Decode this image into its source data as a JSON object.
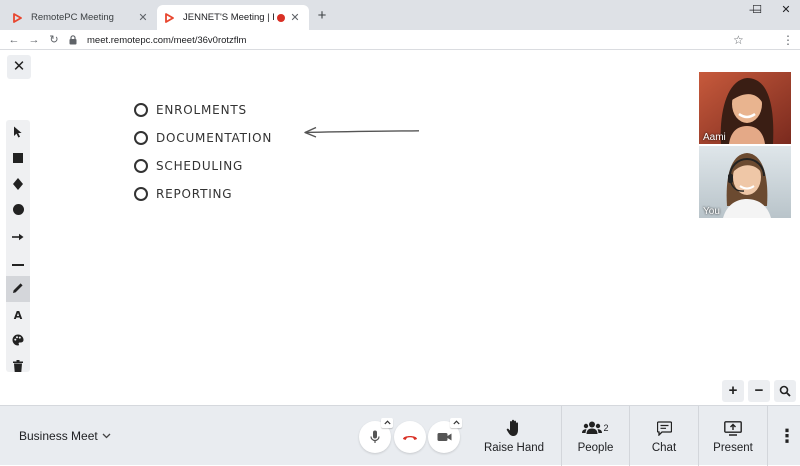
{
  "browser": {
    "tabs": [
      {
        "label": "RemotePC Meeting"
      },
      {
        "label": "JENNET'S  Meeting | RemotePC"
      }
    ],
    "url": "meet.remotepc.com/meet/36v0rotzflm"
  },
  "whiteboard": {
    "items": [
      {
        "label": "ENROLMENTS"
      },
      {
        "label": "DOCUMENTATION"
      },
      {
        "label": "SCHEDULING"
      },
      {
        "label": "REPORTING"
      }
    ]
  },
  "tools": [
    {
      "name": "select",
      "icon": "cursor-icon"
    },
    {
      "name": "rectangle",
      "icon": "square-icon"
    },
    {
      "name": "diamond",
      "icon": "diamond-icon"
    },
    {
      "name": "circle",
      "icon": "circle-icon"
    },
    {
      "name": "arrow",
      "icon": "arrow-right-icon"
    },
    {
      "name": "line",
      "icon": "line-icon"
    },
    {
      "name": "pen",
      "icon": "pencil-icon",
      "active": true
    },
    {
      "name": "text",
      "icon": "text-icon",
      "label": "A"
    },
    {
      "name": "color",
      "icon": "palette-icon"
    },
    {
      "name": "delete",
      "icon": "trash-icon"
    }
  ],
  "participants": [
    {
      "name": "Aami"
    },
    {
      "name": "You"
    }
  ],
  "bottom_bar": {
    "meeting_name": "Business Meet",
    "raise_hand": "Raise Hand",
    "people": "People",
    "people_count": "2",
    "chat": "Chat",
    "present": "Present"
  },
  "colors": {
    "accent": "#e8462f",
    "hangup": "#d93025",
    "bottom_bar_bg": "#e9ecf0"
  }
}
